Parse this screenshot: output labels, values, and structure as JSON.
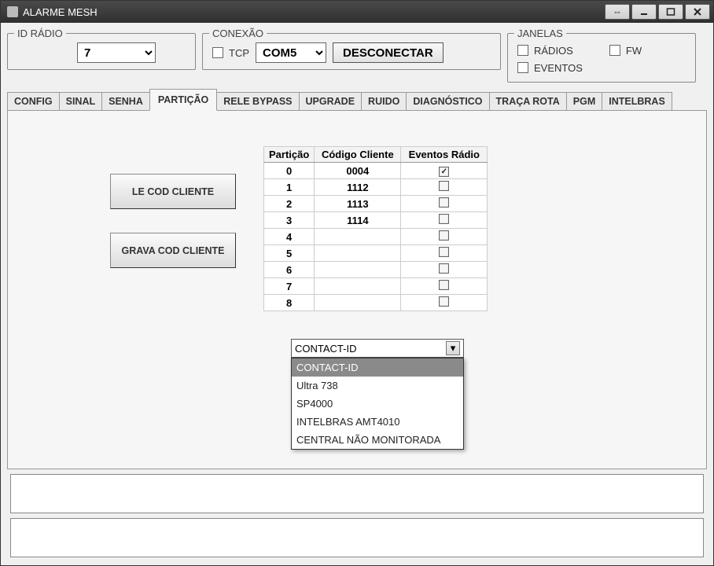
{
  "window": {
    "title": "ALARME MESH"
  },
  "idRadio": {
    "legend": "ID RÁDIO",
    "value": "7"
  },
  "conexao": {
    "legend": "CONEXÃO",
    "tcpLabel": "TCP",
    "tcpChecked": false,
    "port": "COM5",
    "button": "DESCONECTAR"
  },
  "janelas": {
    "legend": "JANELAS",
    "items": [
      {
        "label": "RÁDIOS",
        "checked": false
      },
      {
        "label": "EVENTOS",
        "checked": false
      },
      {
        "label": "FW",
        "checked": false
      }
    ]
  },
  "tabs": [
    "CONFIG",
    "SINAL",
    "SENHA",
    "PARTIÇÃO",
    "RELE BYPASS",
    "UPGRADE",
    "RUIDO",
    "DIAGNÓSTICO",
    "TRAÇA ROTA",
    "PGM",
    "INTELBRAS"
  ],
  "activeTab": "PARTIÇÃO",
  "particao": {
    "btnRead": "LE COD CLIENTE",
    "btnWrite": "GRAVA COD CLIENTE",
    "headers": [
      "Partição",
      "Código Cliente",
      "Eventos Rádio"
    ],
    "rows": [
      {
        "p": "0",
        "code": "0004",
        "ev": true
      },
      {
        "p": "1",
        "code": "1112",
        "ev": false
      },
      {
        "p": "2",
        "code": "1113",
        "ev": false
      },
      {
        "p": "3",
        "code": "1114",
        "ev": false
      },
      {
        "p": "4",
        "code": "",
        "ev": false
      },
      {
        "p": "5",
        "code": "",
        "ev": false
      },
      {
        "p": "6",
        "code": "",
        "ev": false
      },
      {
        "p": "7",
        "code": "",
        "ev": false
      },
      {
        "p": "8",
        "code": "",
        "ev": false
      }
    ],
    "protocol": {
      "selected": "CONTACT-ID",
      "highlight": "CONTACT-ID",
      "options": [
        "CONTACT-ID",
        "Ultra 738",
        "SP4000",
        "INTELBRAS AMT4010",
        "CENTRAL NÃO MONITORADA"
      ]
    }
  }
}
